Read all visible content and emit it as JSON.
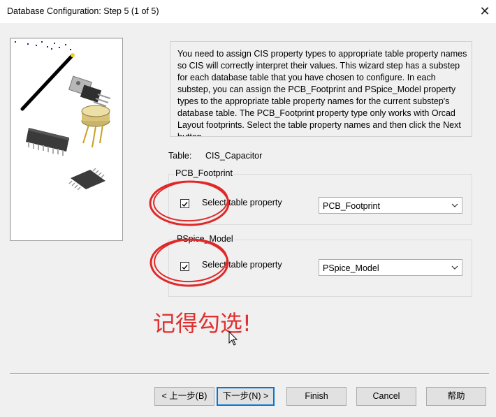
{
  "window": {
    "title": "Database Configuration: Step 5 (1 of 5)",
    "close_glyph": "✕"
  },
  "description": "You need to assign CIS property types to appropriate table property names so CIS will correctly interpret their values. This wizard step has a substep for each database table that you have chosen to configure. In each substep, you can assign the PCB_Footprint and PSpice_Model property types to the appropriate table property names for the current substep's database table. The PCB_Footprint property type only works with Orcad Layout footprints. Select the table property names and then click the Next button.",
  "table": {
    "label": "Table:",
    "name": "CIS_Capacitor"
  },
  "groups": [
    {
      "title": "PCB_Footprint",
      "checkbox_label": "Select table property",
      "checked": true,
      "selected": "PCB_Footprint"
    },
    {
      "title": "PSpice_Model",
      "checkbox_label": "Select table property",
      "checked": true,
      "selected": "PSpice_Model"
    }
  ],
  "annotation": {
    "text": "记得勾选!",
    "color": "#e03030"
  },
  "buttons": {
    "back": "< 上一步(B)",
    "next": "下一步(N) >",
    "finish": "Finish",
    "cancel": "Cancel",
    "help": "帮助"
  },
  "icons": {
    "close": "close-icon",
    "dropdown": "chevron-down-icon",
    "cursor": "mouse-pointer-icon"
  }
}
